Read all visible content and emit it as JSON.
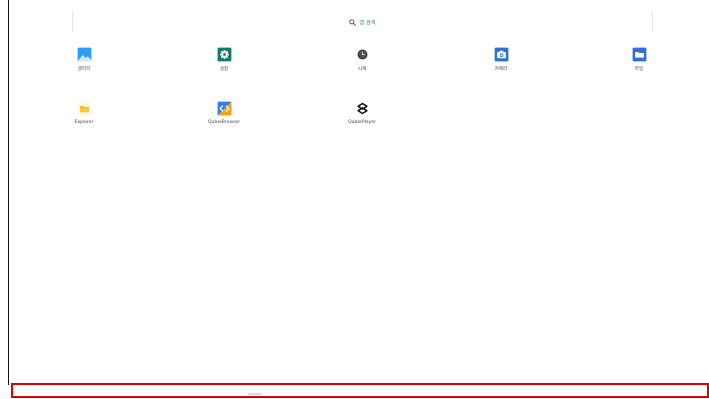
{
  "search": {
    "placeholder": "앱 검색",
    "icon": "search-icon",
    "accent_color": "#1f8a5a"
  },
  "apps": [
    {
      "label": "갤러리",
      "icon": "gallery-icon"
    },
    {
      "label": "설정",
      "icon": "settings-icon"
    },
    {
      "label": "시계",
      "icon": "clock-icon"
    },
    {
      "label": "카메라",
      "icon": "camera-icon"
    },
    {
      "label": "파일",
      "icon": "files-icon"
    },
    {
      "label": "Explorer",
      "icon": "explorer-icon"
    },
    {
      "label": "QuberBrowser",
      "icon": "quberbrowser-icon"
    },
    {
      "label": "QuberPlayer",
      "icon": "quberplayer-icon"
    }
  ],
  "navigation_bar": {
    "highlight_color": "#e00000"
  }
}
